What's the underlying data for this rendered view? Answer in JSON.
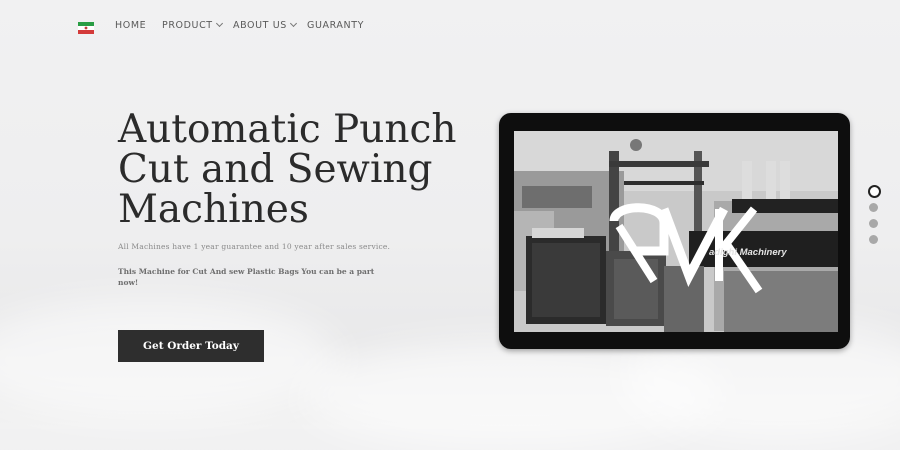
{
  "nav": {
    "items": [
      {
        "label": "HOME",
        "has_dropdown": false
      },
      {
        "label": "PRODUCT",
        "has_dropdown": true
      },
      {
        "label": "ABOUT US",
        "has_dropdown": true
      },
      {
        "label": "GUARANTY",
        "has_dropdown": false
      }
    ],
    "flag_icon": "iran-flag-icon"
  },
  "hero": {
    "title_lines": [
      "Automatic Punch",
      "Cut and Sewing",
      "Machines"
    ],
    "subtitle": "All Machines have 1 year guarantee and 10 year after sales service.",
    "description": "This Machine for Cut And sew Plastic Bags You can be a part now!",
    "cta_label": "Get Order Today"
  },
  "slide": {
    "logo_text": "RVK",
    "brand_text": "adighi Machinery"
  },
  "pager": {
    "count": 4,
    "active_index": 0
  },
  "colors": {
    "cta_bg": "#2e2e2e",
    "title": "#2b2b2b",
    "nav_text": "#5a5a5a",
    "device_frame": "#0e0e0e"
  }
}
